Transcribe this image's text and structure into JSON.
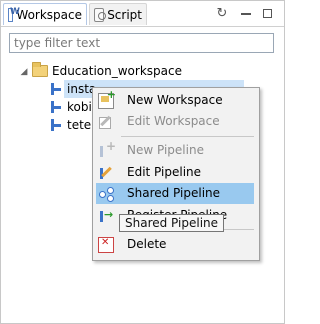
{
  "tabs": [
    {
      "label": "Workspace",
      "icon": "workspace-icon",
      "active": true
    },
    {
      "label": "Script",
      "icon": "script-icon",
      "active": false
    }
  ],
  "toolbar": {
    "refresh_icon": "refresh-icon",
    "minimize_icon": "minimize-icon",
    "maximize_icon": "maximize-icon"
  },
  "filter": {
    "placeholder": "type filter text",
    "value": ""
  },
  "tree": {
    "root": {
      "label": "Education_workspace",
      "expanded": true,
      "icon": "folder-icon"
    },
    "children": [
      {
        "label": "insta",
        "selected": true,
        "icon": "pipeline-icon"
      },
      {
        "label": "kobi",
        "selected": false,
        "icon": "pipeline-icon"
      },
      {
        "label": "tete",
        "selected": false,
        "icon": "pipeline-icon"
      }
    ]
  },
  "context_menu": {
    "items": [
      {
        "label": "New Workspace",
        "enabled": true,
        "icon": "new-workspace-icon"
      },
      {
        "label": "Edit Workspace",
        "enabled": false,
        "icon": "edit-workspace-icon"
      },
      {
        "label": "New Pipeline",
        "enabled": false,
        "icon": "new-pipeline-icon"
      },
      {
        "label": "Edit Pipeline",
        "enabled": true,
        "icon": "edit-pipeline-icon"
      },
      {
        "label": "Shared Pipeline",
        "enabled": true,
        "hovered": true,
        "icon": "shared-pipeline-icon"
      },
      {
        "label": "Register Pipeline",
        "enabled": true,
        "icon": "register-pipeline-icon"
      },
      {
        "label": "Delete",
        "enabled": true,
        "icon": "delete-icon"
      }
    ]
  },
  "tooltip": {
    "text": "Shared Pipeline"
  },
  "colors": {
    "selection": "#cde3f8",
    "menu_hover": "#99c9ef",
    "menu_bg": "#f2f2f2",
    "disabled_text": "#8c8c8c"
  }
}
